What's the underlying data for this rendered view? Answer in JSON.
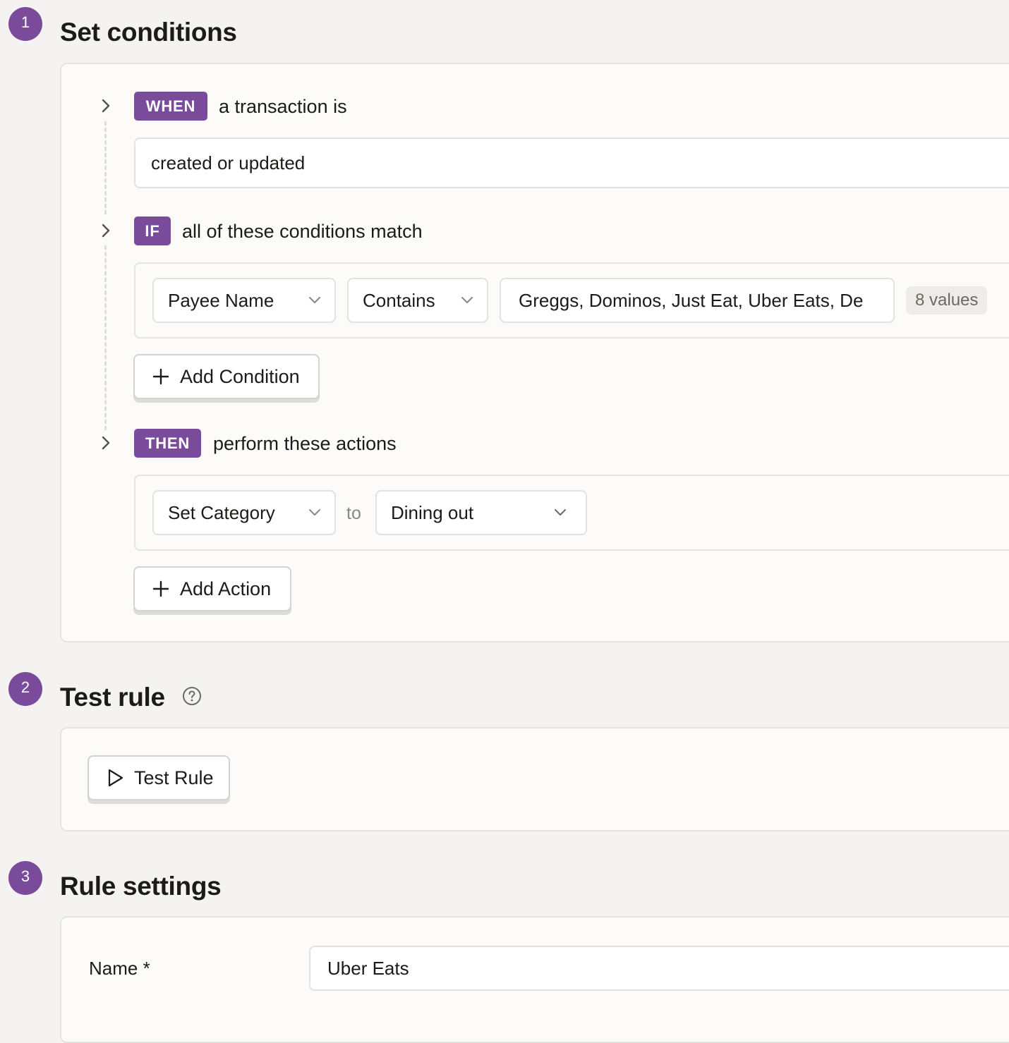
{
  "sections": [
    {
      "number": "1",
      "title": "Set conditions"
    },
    {
      "number": "2",
      "title": "Test rule"
    },
    {
      "number": "3",
      "title": "Rule settings"
    }
  ],
  "when": {
    "label": "WHEN",
    "text": "a transaction is",
    "value": "created or updated"
  },
  "if": {
    "label": "IF",
    "text": "all of these conditions match",
    "condition": {
      "field": "Payee Name",
      "operator": "Contains",
      "value": "Greggs, Dominos, Just Eat, Uber Eats, De",
      "values_count": "8 values"
    },
    "add_button": "Add Condition"
  },
  "then": {
    "label": "THEN",
    "text": "perform these actions",
    "action": {
      "type": "Set Category",
      "connector": "to",
      "value": "Dining out"
    },
    "add_button": "Add Action"
  },
  "test": {
    "button": "Test Rule"
  },
  "settings": {
    "name_label": "Name *",
    "name_value": "Uber Eats"
  },
  "colors": {
    "accent": "#7a4a9b",
    "background": "#f4f3f1",
    "card": "#fcfbfa"
  },
  "icons": {
    "expand": "chevron-right-icon",
    "dropdown": "chevron-down-icon",
    "add": "plus-icon",
    "play": "play-icon",
    "help": "question-circle-icon"
  }
}
